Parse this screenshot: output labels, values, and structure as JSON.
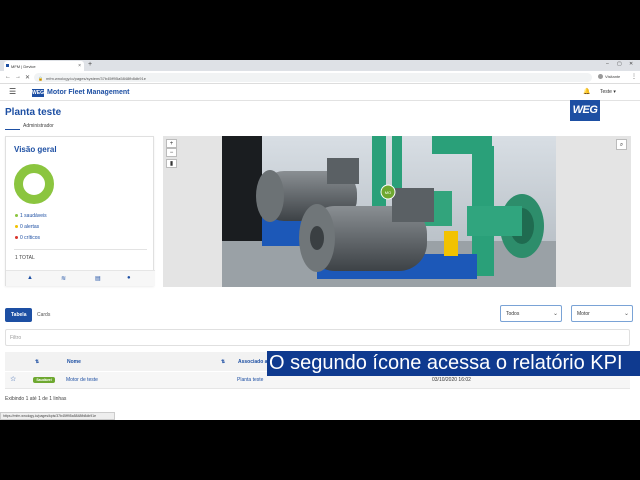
{
  "browser": {
    "tab_title": "MFM | Device",
    "url": "mfm.wnology.io/pages/system/37b45ff95a5848fb8db91e",
    "profile": "Visitante"
  },
  "header": {
    "logo": "WEG",
    "app_title": "Motor Fleet Management",
    "user": "Teste"
  },
  "page": {
    "title": "Planta teste",
    "role": "Administrador",
    "logo": "WEG"
  },
  "overview": {
    "title": "Visão geral",
    "healthy": "1 saudáveis",
    "alerts": "0 alertas",
    "critical": "0 críticos",
    "total": "1 TOTAL",
    "colors": {
      "healthy": "#8bc53f",
      "alert": "#f2c200",
      "critical": "#d9342b"
    },
    "actions": [
      "warning-icon",
      "kpi-report-icon",
      "document-icon",
      "info-icon"
    ]
  },
  "image_panel": {
    "zoom_in": "+",
    "zoom_out": "−",
    "chart_btn": "▮",
    "marker": "MO"
  },
  "view_tabs": [
    "Tabela",
    "Cards"
  ],
  "filters": {
    "status_select": "Todos",
    "type_select": "Motor",
    "filter_placeholder": "Filtro"
  },
  "table": {
    "columns": [
      "Nome",
      "Associado a"
    ],
    "rows": [
      {
        "status": "Saudável",
        "name": "Motor de teste",
        "associated": "Planta teste",
        "date": "03/10/2020 16:02"
      }
    ]
  },
  "footer": {
    "showing": "Exibindo 1 até 1 de 1 linhas",
    "status_url": "https://mfm.wnology.io/pages/kpis/37b45ff95a5848fb8db91e"
  },
  "caption": "O segundo ícone acessa o relatório KPI"
}
